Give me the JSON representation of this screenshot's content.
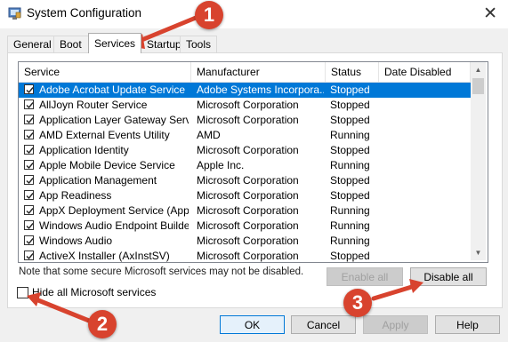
{
  "window": {
    "title": "System Configuration"
  },
  "tabs": [
    "General",
    "Boot",
    "Services",
    "Startup",
    "Tools"
  ],
  "active_tab": "Services",
  "columns": [
    "Service",
    "Manufacturer",
    "Status",
    "Date Disabled"
  ],
  "rows": [
    {
      "service": "Adobe Acrobat Update Service",
      "manufacturer": "Adobe Systems Incorpora...",
      "status": "Stopped",
      "checked": true,
      "selected": true
    },
    {
      "service": "AllJoyn Router Service",
      "manufacturer": "Microsoft Corporation",
      "status": "Stopped",
      "checked": true
    },
    {
      "service": "Application Layer Gateway Service",
      "manufacturer": "Microsoft Corporation",
      "status": "Stopped",
      "checked": true
    },
    {
      "service": "AMD External Events Utility",
      "manufacturer": "AMD",
      "status": "Running",
      "checked": true
    },
    {
      "service": "Application Identity",
      "manufacturer": "Microsoft Corporation",
      "status": "Stopped",
      "checked": true
    },
    {
      "service": "Apple Mobile Device Service",
      "manufacturer": "Apple Inc.",
      "status": "Running",
      "checked": true
    },
    {
      "service": "Application Management",
      "manufacturer": "Microsoft Corporation",
      "status": "Stopped",
      "checked": true
    },
    {
      "service": "App Readiness",
      "manufacturer": "Microsoft Corporation",
      "status": "Stopped",
      "checked": true
    },
    {
      "service": "AppX Deployment Service (AppX...",
      "manufacturer": "Microsoft Corporation",
      "status": "Running",
      "checked": true
    },
    {
      "service": "Windows Audio Endpoint Builder",
      "manufacturer": "Microsoft Corporation",
      "status": "Running",
      "checked": true
    },
    {
      "service": "Windows Audio",
      "manufacturer": "Microsoft Corporation",
      "status": "Running",
      "checked": true
    },
    {
      "service": "ActiveX Installer (AxInstSV)",
      "manufacturer": "Microsoft Corporation",
      "status": "Stopped",
      "checked": true
    }
  ],
  "note": "Note that some secure Microsoft services may not be disabled.",
  "buttons": {
    "enable_all": "Enable all",
    "disable_all": "Disable all",
    "ok": "OK",
    "cancel": "Cancel",
    "apply": "Apply",
    "help": "Help"
  },
  "hide_ms": {
    "label": "Hide all Microsoft services",
    "checked": false
  },
  "annotations": [
    "1",
    "2",
    "3"
  ],
  "colors": {
    "selection": "#0078d7",
    "badge": "#d8432e",
    "focus": "#0078d7"
  },
  "icons": [
    "msconfig-app-icon",
    "close-icon",
    "checkbox-checked-icon",
    "scroll-up-icon",
    "scroll-down-icon"
  ]
}
